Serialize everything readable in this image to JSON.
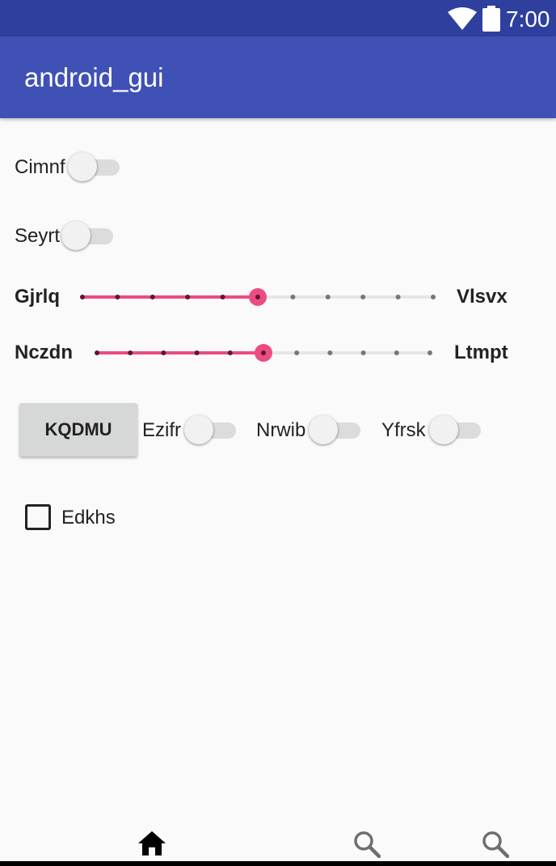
{
  "status_bar": {
    "time": "7:00"
  },
  "app_bar": {
    "title": "android_gui"
  },
  "switches": [
    {
      "label": "Cimnf",
      "checked": false
    },
    {
      "label": "Seyrt",
      "checked": false
    },
    {
      "label": "Ezifr",
      "checked": false
    },
    {
      "label": "Nrwib",
      "checked": false
    },
    {
      "label": "Yfrsk",
      "checked": false
    }
  ],
  "sliders": [
    {
      "left_label": "Gjrlq",
      "right_label": "Vlsvx",
      "value": 5,
      "max": 10
    },
    {
      "left_label": "Nczdn",
      "right_label": "Ltmpt",
      "value": 5,
      "max": 10
    }
  ],
  "button": {
    "label": "KQDMU"
  },
  "checkbox": {
    "label": "Edkhs",
    "checked": false
  },
  "bottom_nav": {
    "items": [
      {
        "icon": "home-icon",
        "selected": true
      },
      {
        "icon": "search-icon",
        "selected": false
      },
      {
        "icon": "search-icon",
        "selected": false
      }
    ]
  },
  "colors": {
    "status_bar": "#2e3f9e",
    "app_bar": "#3f51b5",
    "slider_accent": "#ee4b82"
  }
}
